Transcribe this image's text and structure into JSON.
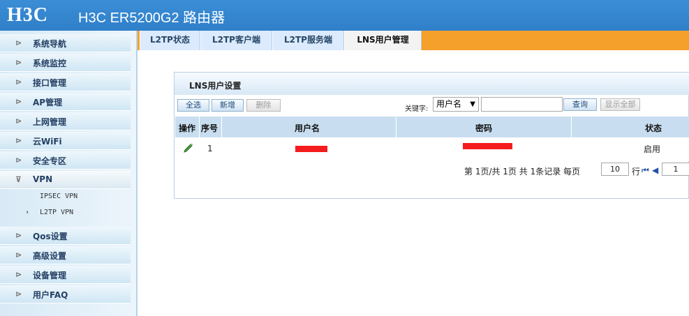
{
  "header": {
    "logo": "H3C",
    "product": "H3C ER5200G2 路由器"
  },
  "sidebar": {
    "items": [
      {
        "label": "系统导航"
      },
      {
        "label": "系统监控"
      },
      {
        "label": "接口管理"
      },
      {
        "label": "AP管理"
      },
      {
        "label": "上网管理"
      },
      {
        "label": "云WiFi"
      },
      {
        "label": "安全专区"
      },
      {
        "label": "VPN"
      },
      {
        "label": "Qos设置"
      },
      {
        "label": "高级设置"
      },
      {
        "label": "设备管理"
      },
      {
        "label": "用户FAQ"
      }
    ],
    "vpn_sub": [
      {
        "label": "IPSEC VPN"
      },
      {
        "label": "L2TP VPN"
      }
    ]
  },
  "tabs": [
    {
      "label": "L2TP状态"
    },
    {
      "label": "L2TP客户端"
    },
    {
      "label": "L2TP服务端"
    },
    {
      "label": "LNS用户管理"
    }
  ],
  "panel": {
    "title": "LNS用户设置",
    "buttons": {
      "select_all": "全选",
      "add": "新增",
      "delete": "删除",
      "search": "查询",
      "show_all": "显示全部"
    },
    "keyword_label": "关键字:",
    "keyword_select": "用户名",
    "table": {
      "headers": [
        "操作",
        "序号",
        "用户名",
        "密码",
        "状态"
      ],
      "rows": [
        {
          "index": "1",
          "status": "启用"
        }
      ]
    },
    "pager": {
      "text": "第 1页/共 1页 共 1条记录 每页",
      "per_page": "10",
      "row_label": "行",
      "page": "1"
    }
  },
  "colors": {
    "header": "#2f7fc9",
    "tab_bar": "#f5a02b",
    "redaction": "#f41c1c"
  }
}
